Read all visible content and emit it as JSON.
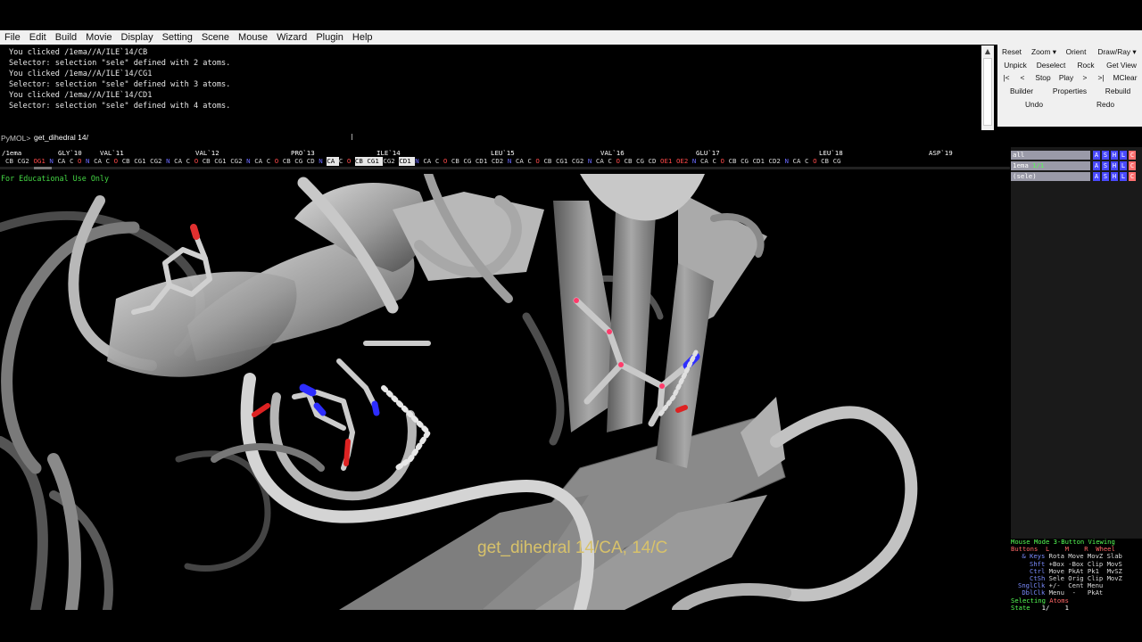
{
  "menu": [
    "File",
    "Edit",
    "Build",
    "Movie",
    "Display",
    "Setting",
    "Scene",
    "Mouse",
    "Wizard",
    "Plugin",
    "Help"
  ],
  "console_lines": [
    "You clicked /1ema//A/ILE`14/CB",
    "Selector: selection \"sele\" defined with 2 atoms.",
    "You clicked /1ema//A/ILE`14/CG1",
    "Selector: selection \"sele\" defined with 3 atoms.",
    "You clicked /1ema//A/ILE`14/CD1",
    "Selector: selection \"sele\" defined with 4 atoms."
  ],
  "command": {
    "prompt": "PyMOL>",
    "value": "get_dihedral 14/"
  },
  "sequence": {
    "residues": [
      "/1ema",
      "GLY`10",
      "VAL`11",
      "VAL`12",
      "PRO`13",
      "ILE`14",
      "LEU`15",
      "VAL`16",
      "GLU`17",
      "LEU`18",
      "ASP`19"
    ],
    "atoms": [
      {
        "t": "CB"
      },
      {
        "t": "CG2"
      },
      {
        "t": "OG1",
        "c": "O"
      },
      {
        "t": "N",
        "c": "N"
      },
      {
        "t": "CA"
      },
      {
        "t": "C"
      },
      {
        "t": "O",
        "c": "O"
      },
      {
        "t": "N",
        "c": "N"
      },
      {
        "t": "CA"
      },
      {
        "t": "C"
      },
      {
        "t": "O",
        "c": "O"
      },
      {
        "t": "CB"
      },
      {
        "t": "CG1"
      },
      {
        "t": "CG2"
      },
      {
        "t": "N",
        "c": "N"
      },
      {
        "t": "CA"
      },
      {
        "t": "C"
      },
      {
        "t": "O",
        "c": "O"
      },
      {
        "t": "CB"
      },
      {
        "t": "CG1"
      },
      {
        "t": "CG2"
      },
      {
        "t": "N",
        "c": "N"
      },
      {
        "t": "CA"
      },
      {
        "t": "C"
      },
      {
        "t": "O",
        "c": "O"
      },
      {
        "t": "CB"
      },
      {
        "t": "CG"
      },
      {
        "t": "CD"
      },
      {
        "t": "N",
        "c": "N"
      },
      {
        "t": "CA",
        "c": "sel"
      },
      {
        "t": "C"
      },
      {
        "t": "O",
        "c": "O"
      },
      {
        "t": "CB",
        "c": "sel"
      },
      {
        "t": "CG1",
        "c": "sel"
      },
      {
        "t": "CG2"
      },
      {
        "t": "CD1",
        "c": "sel"
      },
      {
        "t": "N",
        "c": "N"
      },
      {
        "t": "CA"
      },
      {
        "t": "C"
      },
      {
        "t": "O",
        "c": "O"
      },
      {
        "t": "CB"
      },
      {
        "t": "CG"
      },
      {
        "t": "CD1"
      },
      {
        "t": "CD2"
      },
      {
        "t": "N",
        "c": "N"
      },
      {
        "t": "CA"
      },
      {
        "t": "C"
      },
      {
        "t": "O",
        "c": "O"
      },
      {
        "t": "CB"
      },
      {
        "t": "CG1"
      },
      {
        "t": "CG2"
      },
      {
        "t": "N",
        "c": "N"
      },
      {
        "t": "CA"
      },
      {
        "t": "C"
      },
      {
        "t": "O",
        "c": "O"
      },
      {
        "t": "CB"
      },
      {
        "t": "CG"
      },
      {
        "t": "CD"
      },
      {
        "t": "OE1",
        "c": "O"
      },
      {
        "t": "OE2",
        "c": "O"
      },
      {
        "t": "N",
        "c": "N"
      },
      {
        "t": "CA"
      },
      {
        "t": "C"
      },
      {
        "t": "O",
        "c": "O"
      },
      {
        "t": "CB"
      },
      {
        "t": "CG"
      },
      {
        "t": "CD1"
      },
      {
        "t": "CD2"
      },
      {
        "t": "N",
        "c": "N"
      },
      {
        "t": "CA"
      },
      {
        "t": "C"
      },
      {
        "t": "O",
        "c": "O"
      },
      {
        "t": "CB"
      },
      {
        "t": "CG"
      }
    ]
  },
  "buttons": {
    "reset": "Reset",
    "zoom": "Zoom ▾",
    "orient": "Orient",
    "draw_ray": "Draw/Ray ▾",
    "unpick": "Unpick",
    "deselect": "Deselect",
    "rock": "Rock",
    "get_view": "Get View",
    "rewind": "|<",
    "back": "<",
    "stop": "Stop",
    "play": "Play",
    "forward": ">",
    "end": ">|",
    "mclear": "MClear",
    "builder": "Builder",
    "properties": "Properties",
    "rebuild": "Rebuild",
    "undo": "Undo",
    "redo": "Redo"
  },
  "objects": [
    {
      "name": "all",
      "extra": ""
    },
    {
      "name": "1ema",
      "extra": "1/1"
    },
    {
      "name": "(sele)",
      "extra": ""
    }
  ],
  "obj_buttons": [
    "A",
    "S",
    "H",
    "L",
    "C"
  ],
  "mouse_mode": {
    "title": "Mouse Mode 3-Button Viewing",
    "header": "Buttons  L    M    R  Wheel",
    "rows": [
      [
        "& Keys",
        "Rota Move MovZ Slab"
      ],
      [
        "Shft",
        "+Box -Box Clip MovS"
      ],
      [
        "Ctrl",
        "Move PkAt Pk1  MvSZ"
      ],
      [
        "CtSh",
        "Sele Orig Clip MovZ"
      ],
      [
        "SnglClk",
        "+/-  Cent Menu"
      ],
      [
        "DblClk",
        "Menu  -   PkAt"
      ]
    ],
    "selecting_label": "Selecting",
    "selecting_value": "Atoms",
    "state_label": "State",
    "state_value": "1/    1"
  },
  "viewport": {
    "watermark": "For Educational Use Only",
    "caption": "get_dihedral 14/CA, 14/C"
  }
}
